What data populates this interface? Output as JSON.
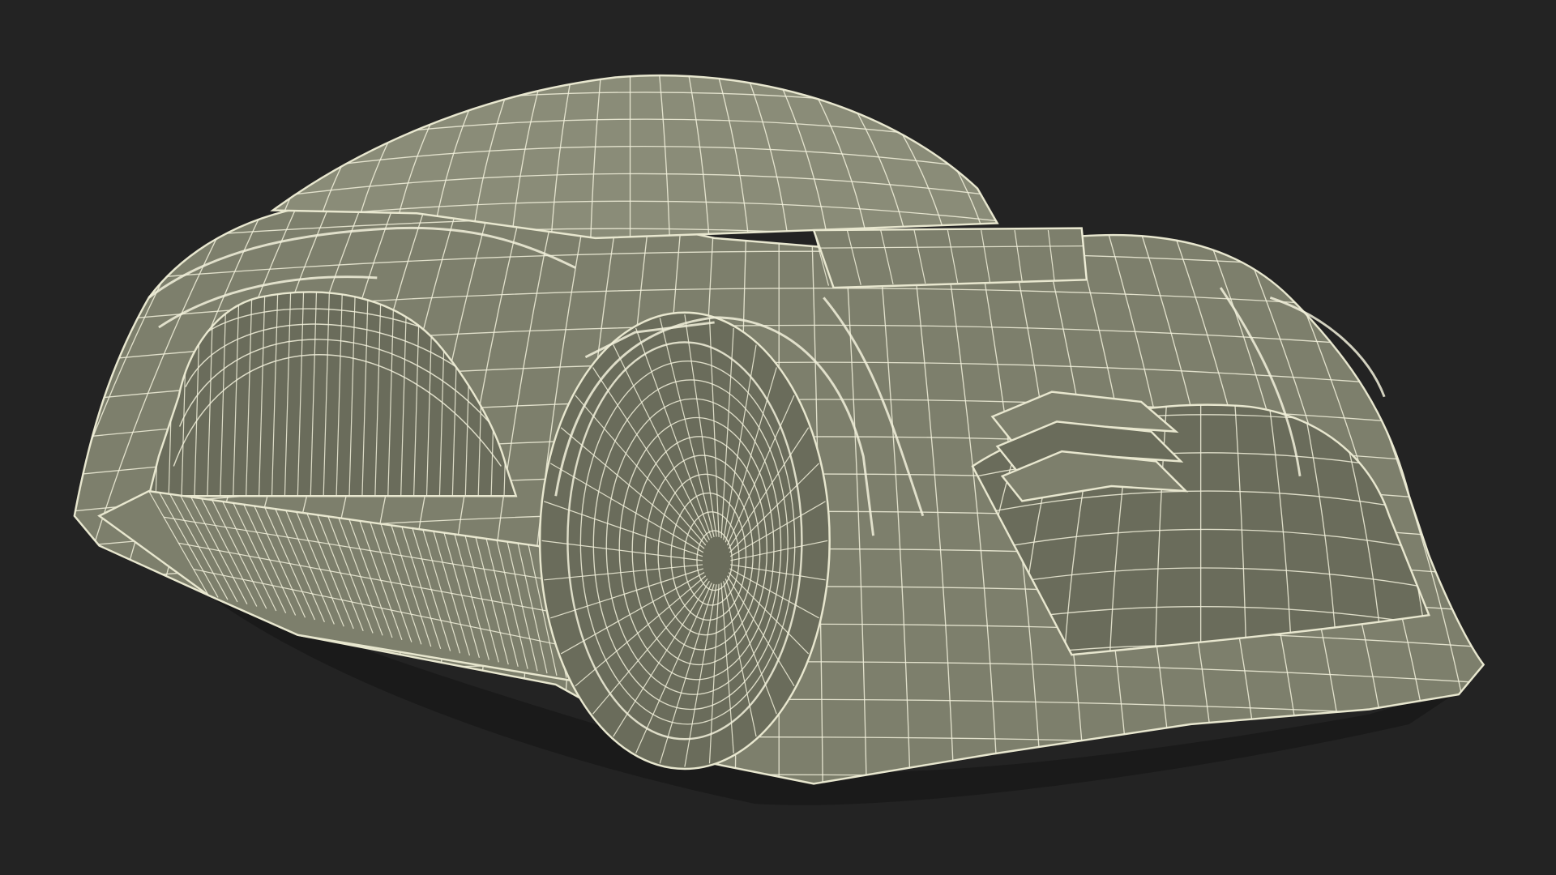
{
  "viewport": {
    "background_color": "#232323"
  },
  "model": {
    "surface_color": "#7d7f6c",
    "surface_shadow_color": "#6a6c5b",
    "surface_highlight_color": "#8a8c78",
    "wireframe_color": "#f2f1dc",
    "outline_color": "#e8e7cf"
  }
}
